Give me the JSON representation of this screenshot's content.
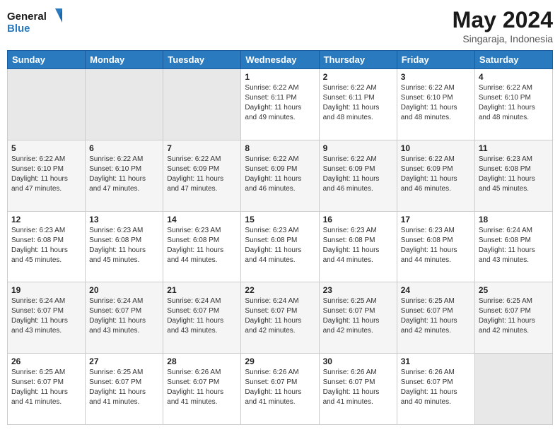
{
  "logo": {
    "line1": "General",
    "line2": "Blue"
  },
  "title": "May 2024",
  "subtitle": "Singaraja, Indonesia",
  "header_row": [
    "Sunday",
    "Monday",
    "Tuesday",
    "Wednesday",
    "Thursday",
    "Friday",
    "Saturday"
  ],
  "weeks": [
    [
      {
        "day": "",
        "info": ""
      },
      {
        "day": "",
        "info": ""
      },
      {
        "day": "",
        "info": ""
      },
      {
        "day": "1",
        "info": "Sunrise: 6:22 AM\nSunset: 6:11 PM\nDaylight: 11 hours\nand 49 minutes."
      },
      {
        "day": "2",
        "info": "Sunrise: 6:22 AM\nSunset: 6:11 PM\nDaylight: 11 hours\nand 48 minutes."
      },
      {
        "day": "3",
        "info": "Sunrise: 6:22 AM\nSunset: 6:10 PM\nDaylight: 11 hours\nand 48 minutes."
      },
      {
        "day": "4",
        "info": "Sunrise: 6:22 AM\nSunset: 6:10 PM\nDaylight: 11 hours\nand 48 minutes."
      }
    ],
    [
      {
        "day": "5",
        "info": "Sunrise: 6:22 AM\nSunset: 6:10 PM\nDaylight: 11 hours\nand 47 minutes."
      },
      {
        "day": "6",
        "info": "Sunrise: 6:22 AM\nSunset: 6:10 PM\nDaylight: 11 hours\nand 47 minutes."
      },
      {
        "day": "7",
        "info": "Sunrise: 6:22 AM\nSunset: 6:09 PM\nDaylight: 11 hours\nand 47 minutes."
      },
      {
        "day": "8",
        "info": "Sunrise: 6:22 AM\nSunset: 6:09 PM\nDaylight: 11 hours\nand 46 minutes."
      },
      {
        "day": "9",
        "info": "Sunrise: 6:22 AM\nSunset: 6:09 PM\nDaylight: 11 hours\nand 46 minutes."
      },
      {
        "day": "10",
        "info": "Sunrise: 6:22 AM\nSunset: 6:09 PM\nDaylight: 11 hours\nand 46 minutes."
      },
      {
        "day": "11",
        "info": "Sunrise: 6:23 AM\nSunset: 6:08 PM\nDaylight: 11 hours\nand 45 minutes."
      }
    ],
    [
      {
        "day": "12",
        "info": "Sunrise: 6:23 AM\nSunset: 6:08 PM\nDaylight: 11 hours\nand 45 minutes."
      },
      {
        "day": "13",
        "info": "Sunrise: 6:23 AM\nSunset: 6:08 PM\nDaylight: 11 hours\nand 45 minutes."
      },
      {
        "day": "14",
        "info": "Sunrise: 6:23 AM\nSunset: 6:08 PM\nDaylight: 11 hours\nand 44 minutes."
      },
      {
        "day": "15",
        "info": "Sunrise: 6:23 AM\nSunset: 6:08 PM\nDaylight: 11 hours\nand 44 minutes."
      },
      {
        "day": "16",
        "info": "Sunrise: 6:23 AM\nSunset: 6:08 PM\nDaylight: 11 hours\nand 44 minutes."
      },
      {
        "day": "17",
        "info": "Sunrise: 6:23 AM\nSunset: 6:08 PM\nDaylight: 11 hours\nand 44 minutes."
      },
      {
        "day": "18",
        "info": "Sunrise: 6:24 AM\nSunset: 6:08 PM\nDaylight: 11 hours\nand 43 minutes."
      }
    ],
    [
      {
        "day": "19",
        "info": "Sunrise: 6:24 AM\nSunset: 6:07 PM\nDaylight: 11 hours\nand 43 minutes."
      },
      {
        "day": "20",
        "info": "Sunrise: 6:24 AM\nSunset: 6:07 PM\nDaylight: 11 hours\nand 43 minutes."
      },
      {
        "day": "21",
        "info": "Sunrise: 6:24 AM\nSunset: 6:07 PM\nDaylight: 11 hours\nand 43 minutes."
      },
      {
        "day": "22",
        "info": "Sunrise: 6:24 AM\nSunset: 6:07 PM\nDaylight: 11 hours\nand 42 minutes."
      },
      {
        "day": "23",
        "info": "Sunrise: 6:25 AM\nSunset: 6:07 PM\nDaylight: 11 hours\nand 42 minutes."
      },
      {
        "day": "24",
        "info": "Sunrise: 6:25 AM\nSunset: 6:07 PM\nDaylight: 11 hours\nand 42 minutes."
      },
      {
        "day": "25",
        "info": "Sunrise: 6:25 AM\nSunset: 6:07 PM\nDaylight: 11 hours\nand 42 minutes."
      }
    ],
    [
      {
        "day": "26",
        "info": "Sunrise: 6:25 AM\nSunset: 6:07 PM\nDaylight: 11 hours\nand 41 minutes."
      },
      {
        "day": "27",
        "info": "Sunrise: 6:25 AM\nSunset: 6:07 PM\nDaylight: 11 hours\nand 41 minutes."
      },
      {
        "day": "28",
        "info": "Sunrise: 6:26 AM\nSunset: 6:07 PM\nDaylight: 11 hours\nand 41 minutes."
      },
      {
        "day": "29",
        "info": "Sunrise: 6:26 AM\nSunset: 6:07 PM\nDaylight: 11 hours\nand 41 minutes."
      },
      {
        "day": "30",
        "info": "Sunrise: 6:26 AM\nSunset: 6:07 PM\nDaylight: 11 hours\nand 41 minutes."
      },
      {
        "day": "31",
        "info": "Sunrise: 6:26 AM\nSunset: 6:07 PM\nDaylight: 11 hours\nand 40 minutes."
      },
      {
        "day": "",
        "info": ""
      }
    ]
  ]
}
